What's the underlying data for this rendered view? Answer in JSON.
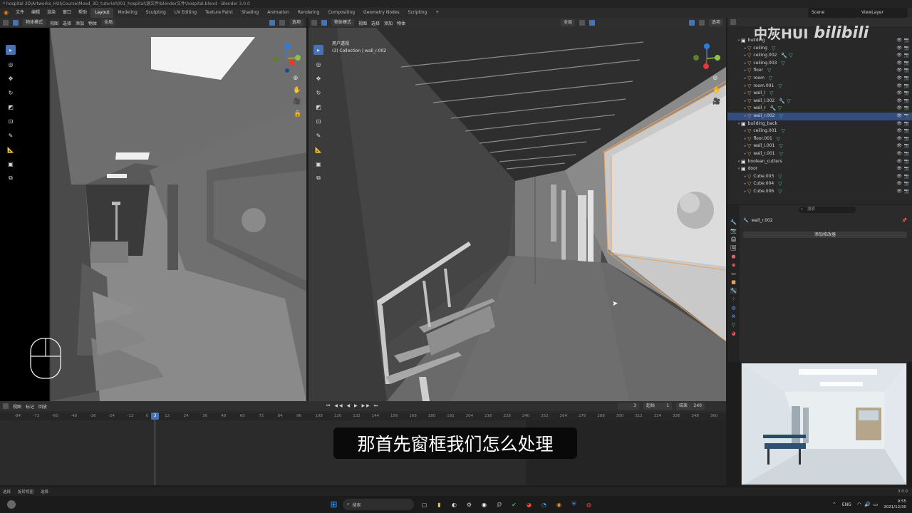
{
  "window": {
    "title": "* hospital 3D\\Artworks_HUI\\Course\\Mood_3D_tutorial\\001_hospital\\源文件\\blender文件\\hospital.blend - Blender 3.0.0"
  },
  "menu": {
    "items": [
      "文件",
      "编辑",
      "渲染",
      "窗口",
      "帮助"
    ],
    "workspaces": [
      "Layout",
      "Modeling",
      "Sculpting",
      "UV Editing",
      "Texture Paint",
      "Shading",
      "Animation",
      "Rendering",
      "Compositing",
      "Geometry Nodes",
      "Scripting"
    ],
    "active_workspace": "Layout",
    "add": "+",
    "scene_label": "Scene",
    "viewlayer_label": "ViewLayer"
  },
  "viewport_left": {
    "mode": "物体模式",
    "menus": [
      "视图",
      "选择",
      "添加",
      "物体"
    ],
    "orientation": "全局",
    "options": "选项"
  },
  "viewport_right": {
    "mode": "物体模式",
    "menus": [
      "视图",
      "选择",
      "添加",
      "物体"
    ],
    "orientation": "全局",
    "options": "选项",
    "view_name": "用户透视",
    "collection_info": "(3) Collection | wall_r.002"
  },
  "watermark": {
    "name": "中灰HUI",
    "site": "bilibili"
  },
  "outliner": {
    "rows": [
      {
        "indent": 1,
        "kind": "col",
        "label": "building",
        "mods": "",
        "selected": false
      },
      {
        "indent": 2,
        "kind": "obj",
        "label": "ceiling",
        "mods": "▽",
        "selected": false
      },
      {
        "indent": 2,
        "kind": "obj",
        "label": "ceiling.002",
        "mods": "🔧 ▽",
        "selected": false
      },
      {
        "indent": 2,
        "kind": "obj",
        "label": "ceiling.003",
        "mods": "▽",
        "selected": false
      },
      {
        "indent": 2,
        "kind": "obj",
        "label": "floor",
        "mods": "▽",
        "selected": false
      },
      {
        "indent": 2,
        "kind": "obj",
        "label": "room",
        "mods": "▽",
        "selected": false
      },
      {
        "indent": 2,
        "kind": "obj",
        "label": "room.001",
        "mods": "▽",
        "selected": false
      },
      {
        "indent": 2,
        "kind": "obj",
        "label": "wall_l",
        "mods": "▽",
        "selected": false
      },
      {
        "indent": 2,
        "kind": "obj",
        "label": "wall_l.002",
        "mods": "🔧 ▽",
        "selected": false
      },
      {
        "indent": 2,
        "kind": "obj",
        "label": "wall_r",
        "mods": "🔧 ▽",
        "selected": false
      },
      {
        "indent": 2,
        "kind": "obj",
        "label": "wall_r.002",
        "mods": "▽",
        "selected": true
      },
      {
        "indent": 1,
        "kind": "col",
        "label": "building_back",
        "mods": "",
        "selected": false
      },
      {
        "indent": 2,
        "kind": "obj",
        "label": "ceiling.001",
        "mods": "▽",
        "selected": false
      },
      {
        "indent": 2,
        "kind": "obj",
        "label": "floor.001",
        "mods": "▽",
        "selected": false
      },
      {
        "indent": 2,
        "kind": "obj",
        "label": "wall_l.001",
        "mods": "▽",
        "selected": false
      },
      {
        "indent": 2,
        "kind": "obj",
        "label": "wall_r.001",
        "mods": "▽",
        "selected": false
      },
      {
        "indent": 1,
        "kind": "col",
        "label": "boolean_cutters",
        "mods": "",
        "selected": false
      },
      {
        "indent": 1,
        "kind": "col",
        "label": "door",
        "mods": "",
        "selected": false
      },
      {
        "indent": 2,
        "kind": "obj",
        "label": "Cube.003",
        "mods": "▽",
        "selected": false
      },
      {
        "indent": 2,
        "kind": "obj",
        "label": "Cube.004",
        "mods": "▽",
        "selected": false
      },
      {
        "indent": 2,
        "kind": "obj",
        "label": "Cube.006",
        "mods": "▽",
        "selected": false
      }
    ]
  },
  "properties": {
    "search_placeholder": "搜索",
    "object_name": "wall_r.002",
    "add_modifier": "添加修改器"
  },
  "timeline": {
    "menus": [
      "视图",
      "标记",
      "回放"
    ],
    "current_frame": "3",
    "start_label": "起始",
    "start": "1",
    "end_label": "结束",
    "end": "240",
    "ruler": [
      "-84",
      "-72",
      "-60",
      "-48",
      "-36",
      "-24",
      "-12",
      "0",
      "12",
      "24",
      "36",
      "48",
      "60",
      "72",
      "84",
      "96",
      "108",
      "120",
      "132",
      "144",
      "156",
      "168",
      "180",
      "192",
      "204",
      "216",
      "228",
      "240",
      "252",
      "264",
      "276",
      "288",
      "300",
      "312",
      "324",
      "336",
      "348",
      "360"
    ],
    "playhead_label": "3"
  },
  "subtitle": "那首先窗框我们怎么处理",
  "statusbar": {
    "items": [
      "选择",
      "旋转视图",
      "选择"
    ],
    "version": "3.0.0"
  },
  "taskbar": {
    "search": "搜索",
    "lang": "ENG",
    "time": "9:55",
    "date": "2021/12/30"
  },
  "colors": {
    "accent_blue": "#4772b3",
    "selection_orange": "#e8a15a",
    "modifier_green": "#4fc3a0"
  }
}
